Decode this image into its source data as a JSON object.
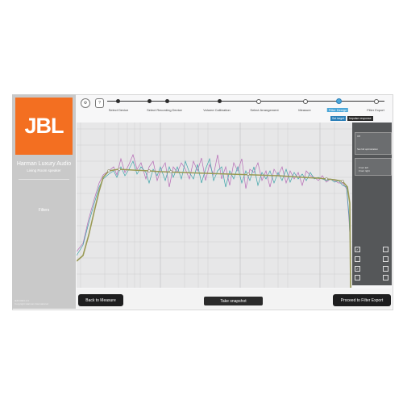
{
  "sidebar": {
    "logo_text": "JBL",
    "product": "Harman Luxury Audio",
    "subtitle": "Living Room speaker",
    "filters_label": "Filters",
    "version": "IEM 0004.1.0",
    "copyright": "Copyright Harman International"
  },
  "toolbar": {
    "settings_label": "⚙",
    "help_label": "?"
  },
  "steps": [
    {
      "label": "Select Device"
    },
    {
      "label": "Select Recording Device"
    },
    {
      "label": "Volume Calibration"
    },
    {
      "label": "Select Arrangement"
    },
    {
      "label": "Measure"
    },
    {
      "label": "Filter Design"
    },
    {
      "label": "Filter Export"
    }
  ],
  "tags": {
    "set_target": "Set target",
    "impulse": "Impulse response"
  },
  "panel": {
    "opt1": "Off",
    "opt2": "Set full optimization",
    "legend1": "Front left",
    "legend2": "Front right"
  },
  "buttons": {
    "back": "Back to Measure",
    "snapshot": "Take snapshot",
    "proceed": "Proceed to Filter Export"
  },
  "colors": {
    "accent": "#f36f21",
    "current_step": "#4aa6d8",
    "curve1": "#b56ab5",
    "curve2": "#3da3a8",
    "target": "#9a9a55"
  }
}
